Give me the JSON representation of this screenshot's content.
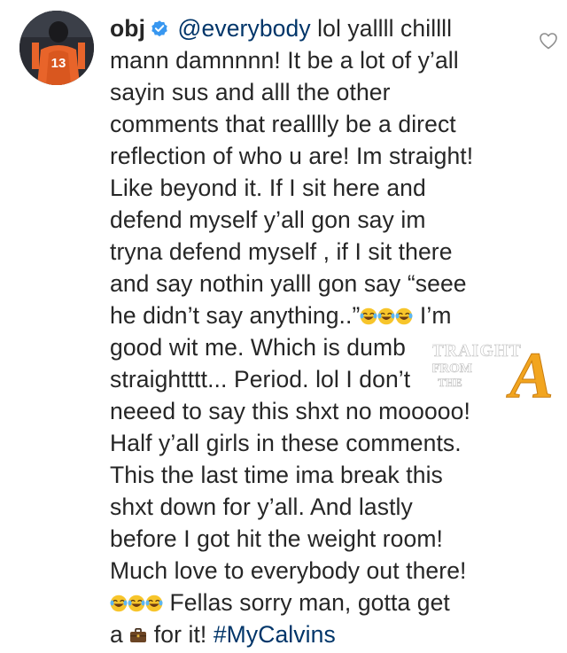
{
  "comment": {
    "username": "obj",
    "verified": true,
    "mention": "@everybody",
    "body_part1": " lol yallll chillll\nmann damnnnn! It be a lot of y’all\nsayin sus and alll the other\ncomments that realllly be a direct\nreflection of who u are! Im straight!\nLike beyond it. If I sit here and\ndefend myself y’all gon say im\ntryna defend myself , if I sit there\nand say nothin yalll gon say “seee\nhe didn’t say anything..”",
    "body_part2": " I’m\ngood wit me. Which is dumb\nstraightttt... Period. lol I don’t\nneeed to say this shxt no mooooo!\nHalf y’all girls in these comments.\nThis the last time ima break this\nshxt down for y’all. And lastly\nbefore I got hit the weight room!\nMuch love to everybody out there!\n",
    "body_part3": " Fellas sorry man, gotta get\na ",
    "body_part4": " for it! ",
    "hashtag": "#MyCalvins",
    "emoji_laughing": "face-with-tears-of-joy-emoji",
    "emoji_briefcase": "briefcase-emoji",
    "avatar_jersey_number": "13",
    "avatar_accent_color": "#e8642a"
  },
  "like_icon": "heart-outline-icon",
  "colors": {
    "text": "#262626",
    "link": "#003569",
    "verified": "#3897f0"
  },
  "watermark": {
    "line1": "STRAIGHT",
    "line2": "FROM",
    "line3": "THE",
    "letter": "A"
  }
}
